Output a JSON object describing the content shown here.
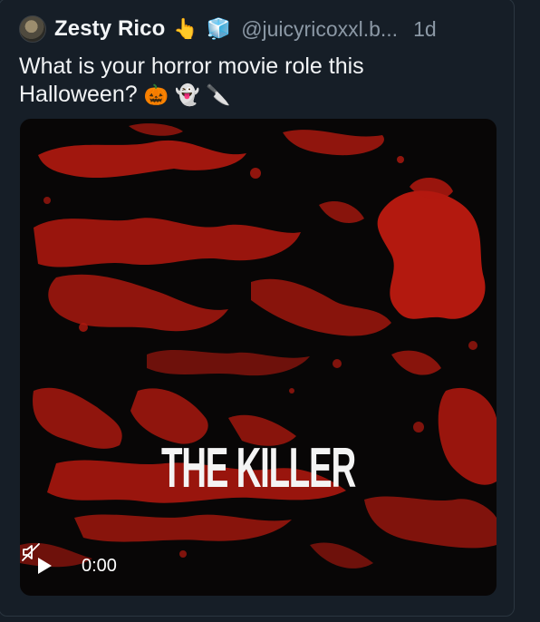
{
  "post": {
    "display_name": "Zesty Rico",
    "name_emojis": [
      "👆",
      "🧊"
    ],
    "handle": "@juicyricoxxl.b...",
    "timestamp": "1d",
    "text_line1": "What is your horror movie role this",
    "text_line2": "Halloween?",
    "text_emojis": [
      "🎃",
      "👻",
      "🔪"
    ]
  },
  "media": {
    "title": "THE KILLER",
    "time": "0:00",
    "icons": {
      "play": "play-icon",
      "mute": "muted-speaker-icon"
    },
    "colors": {
      "background": "#080606",
      "blood": "#b3190f"
    }
  },
  "colors": {
    "page_bg": "#161e27",
    "muted_text": "#8b98a5",
    "card_border": "#2b3640"
  }
}
